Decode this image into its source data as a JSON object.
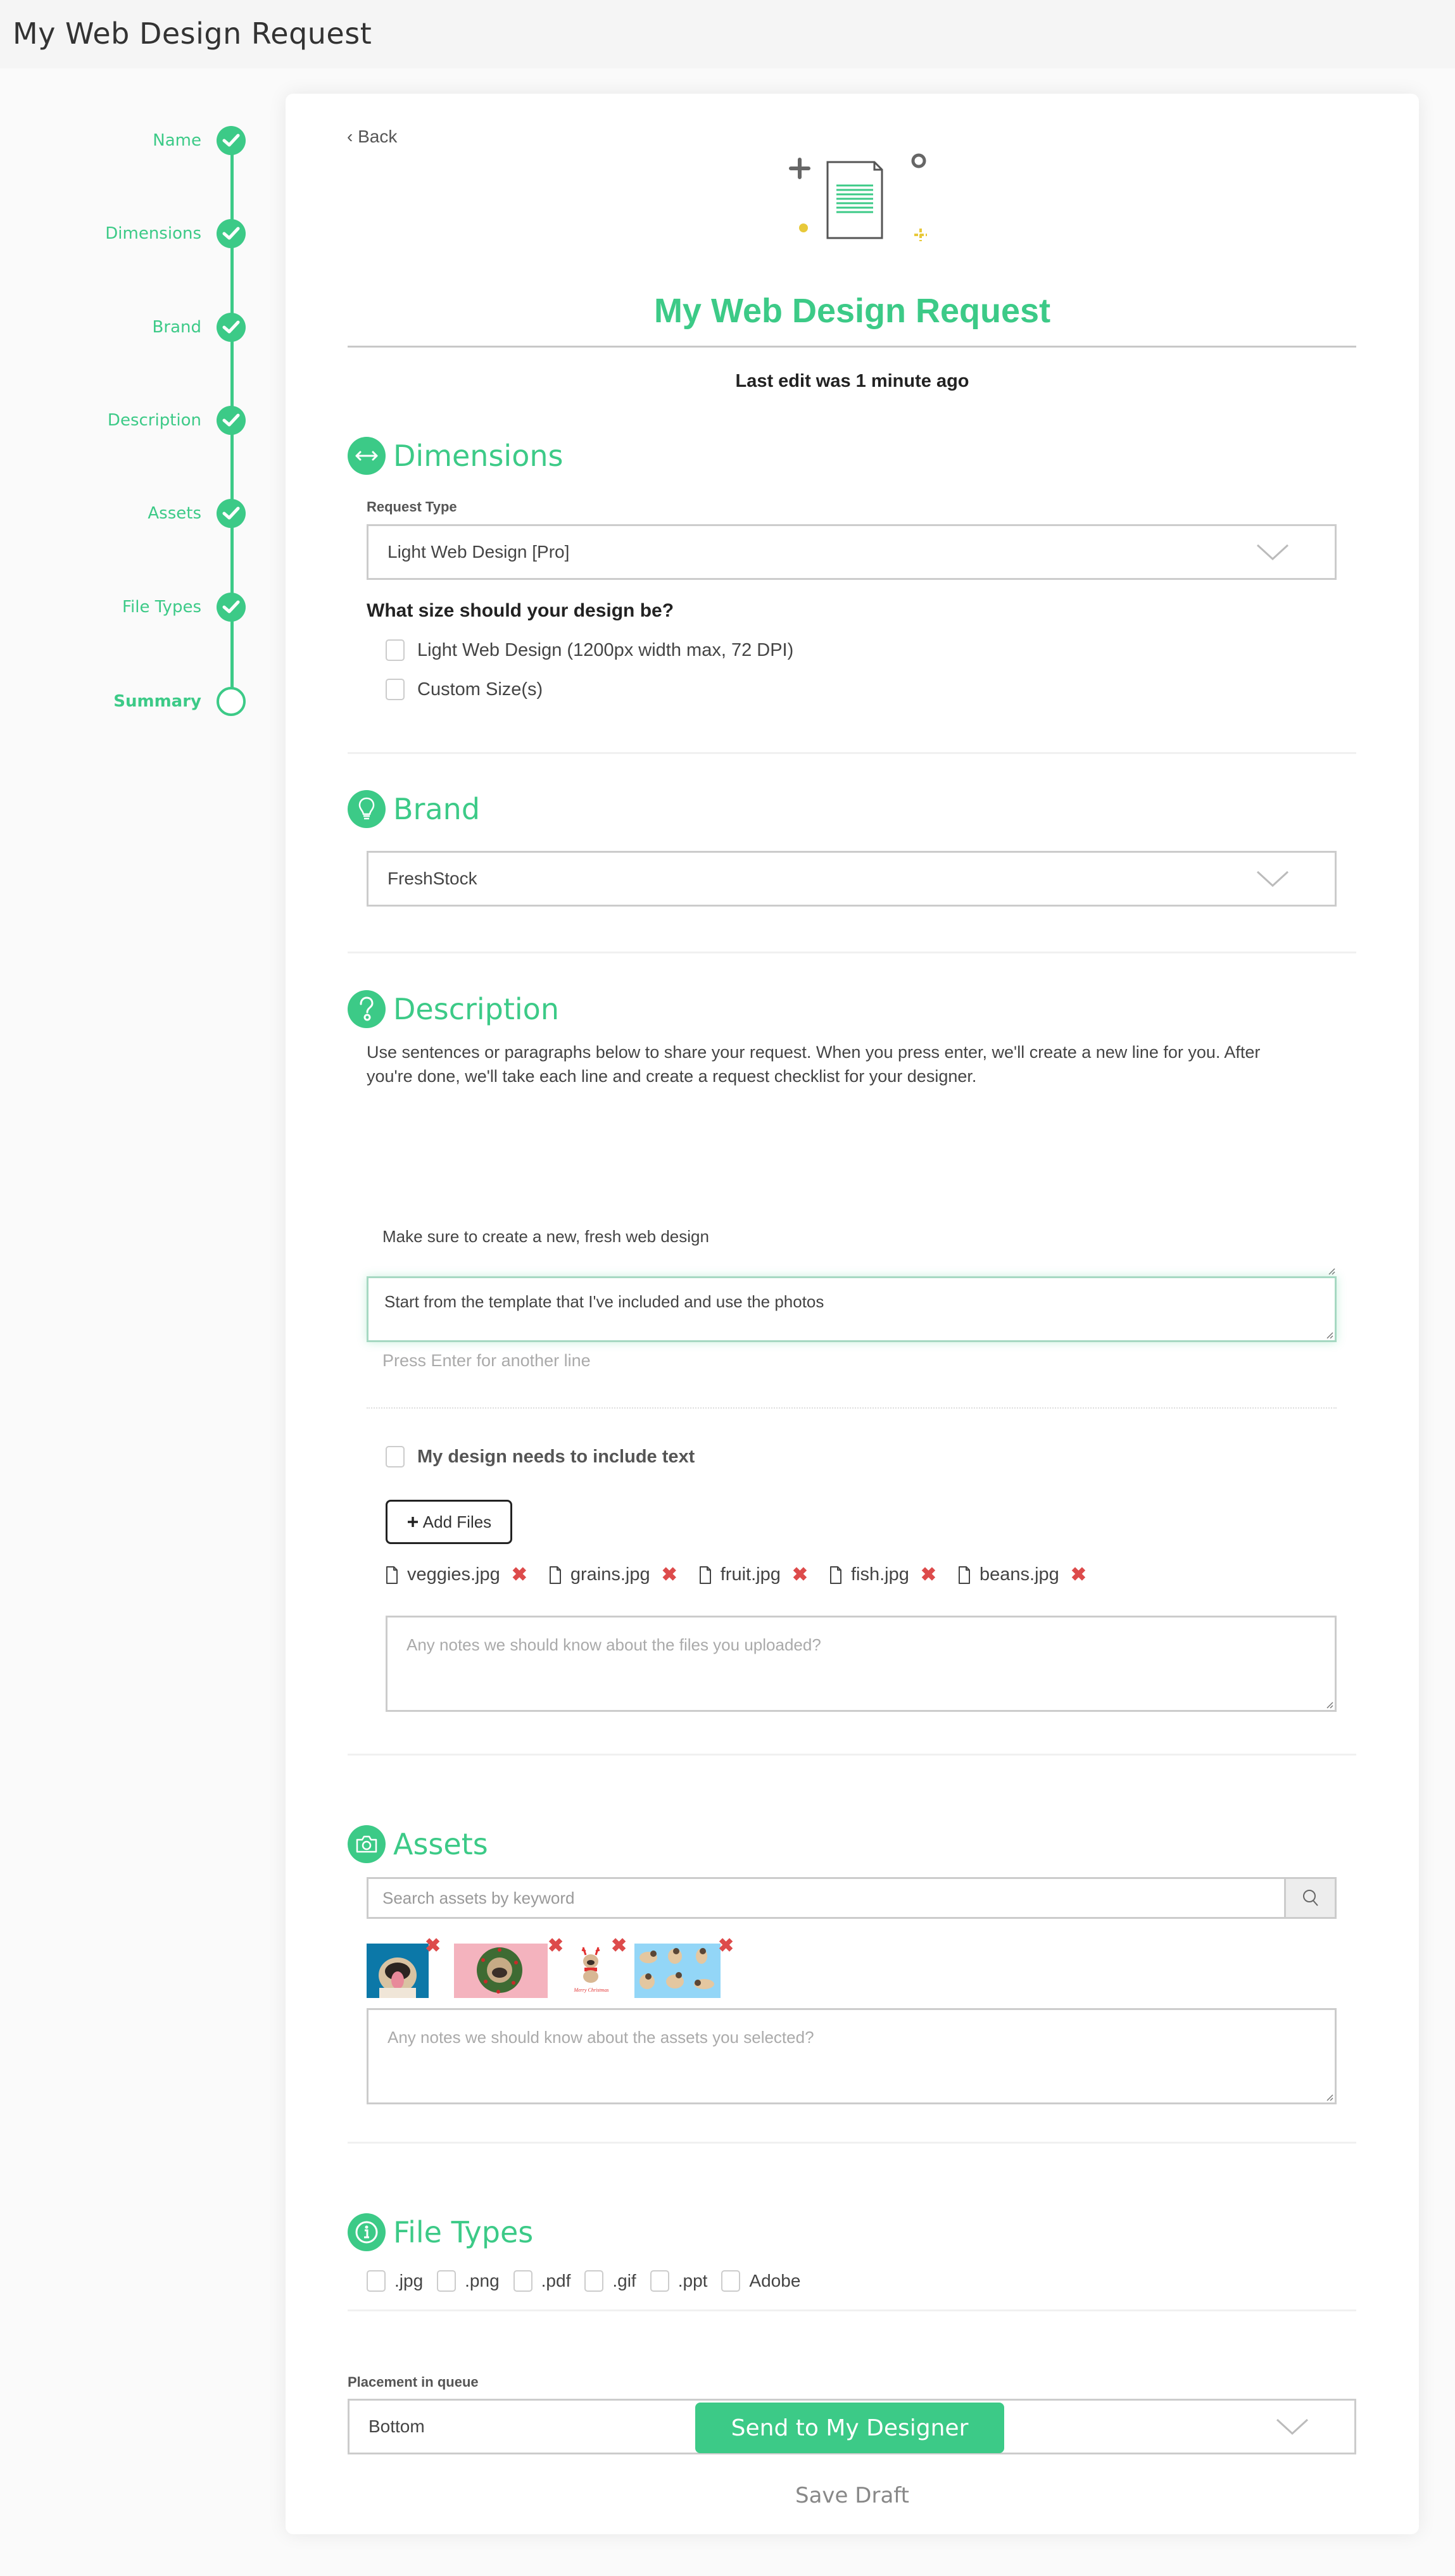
{
  "app": {
    "title": "My Web Design Request"
  },
  "stepper": {
    "steps": [
      {
        "label": "Name",
        "status": "complete"
      },
      {
        "label": "Dimensions",
        "status": "complete"
      },
      {
        "label": "Brand",
        "status": "complete"
      },
      {
        "label": "Description",
        "status": "complete"
      },
      {
        "label": "Assets",
        "status": "complete"
      },
      {
        "label": "File Types",
        "status": "complete"
      },
      {
        "label": "Summary",
        "status": "current"
      }
    ]
  },
  "header": {
    "back_label": "‹ Back",
    "title": "My Web Design Request",
    "last_edit": "Last edit was 1 minute ago",
    "hero_icon": "document-illustration"
  },
  "colors": {
    "accent": "#3cca87",
    "danger": "#dd4b4b",
    "border": "#cccccc"
  },
  "dimensions": {
    "title": "Dimensions",
    "icon": "arrows-horizontal-icon",
    "request_type_label": "Request Type",
    "request_type_value": "Light Web Design [Pro]",
    "size_question": "What size should your design be?",
    "size_options": [
      {
        "label": "Light Web Design (1200px width max, 72 DPI)",
        "checked": false
      },
      {
        "label": "Custom Size(s)",
        "checked": false
      }
    ]
  },
  "brand": {
    "title": "Brand",
    "icon": "lightbulb-icon",
    "value": "FreshStock"
  },
  "description": {
    "title": "Description",
    "icon": "question-icon",
    "instructions": "Use sentences or paragraphs below to share your request. When you press enter, we'll create a new line for you. After you're done, we'll take each line and create a request checklist for your designer.",
    "lines": [
      "Make sure to create a new, fresh web design",
      "Start from the template that I've included and use the photos"
    ],
    "next_line_placeholder": "Press Enter for another line",
    "include_text_label": "My design needs to include text",
    "include_text_checked": false,
    "add_files_label": "Add Files",
    "files": [
      "veggies.jpg",
      "grains.jpg",
      "fruit.jpg",
      "fish.jpg",
      "beans.jpg"
    ],
    "files_notes_placeholder": "Any notes we should know about the files you uploaded?"
  },
  "assets": {
    "title": "Assets",
    "icon": "camera-icon",
    "search_placeholder": "Search assets by keyword",
    "selected": [
      {
        "name": "pug-yawning-blue"
      },
      {
        "name": "pug-wreath-pink"
      },
      {
        "name": "pug-reindeer-christmas-card",
        "caption": "Merry Christmas"
      },
      {
        "name": "pug-illustrations-blue"
      }
    ],
    "notes_placeholder": "Any notes we should know about the assets you selected?"
  },
  "file_types": {
    "title": "File Types",
    "icon": "info-icon",
    "options": [
      {
        "label": ".jpg",
        "checked": false
      },
      {
        "label": ".png",
        "checked": false
      },
      {
        "label": ".pdf",
        "checked": false
      },
      {
        "label": ".gif",
        "checked": false
      },
      {
        "label": ".ppt",
        "checked": false
      },
      {
        "label": "Adobe",
        "checked": false
      }
    ]
  },
  "queue": {
    "label": "Placement in queue",
    "value": "Bottom"
  },
  "actions": {
    "send_label": "Send to My Designer",
    "draft_label": "Save Draft"
  }
}
